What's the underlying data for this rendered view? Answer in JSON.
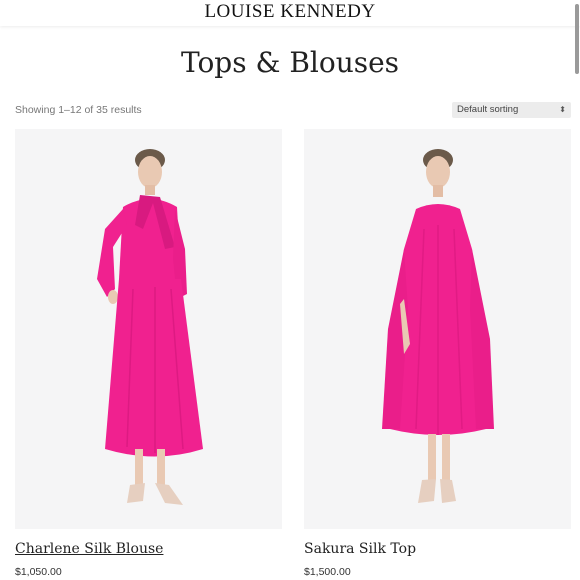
{
  "header": {
    "brand": "LOUISE KENNEDY"
  },
  "page": {
    "title": "Tops & Blouses"
  },
  "toolbar": {
    "result_count": "Showing 1–12 of 35 results",
    "sort_selected": "Default sorting"
  },
  "products": [
    {
      "name": "Charlene Silk Blouse",
      "price": "$1,050.00",
      "garment_color": "#f0218f"
    },
    {
      "name": "Sakura Silk Top",
      "price": "$1,500.00",
      "garment_color": "#f0218f"
    }
  ],
  "colors": {
    "image_bg": "#f5f5f6",
    "skin": "#e9c9b3",
    "hair": "#6b5a4a"
  }
}
